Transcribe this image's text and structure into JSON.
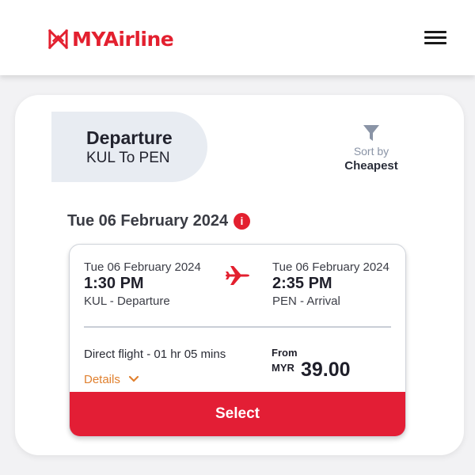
{
  "header": {
    "logo_text": "MYAirline",
    "logo_icon": "myairline-emblem",
    "menu_icon": "hamburger-menu-icon"
  },
  "colors": {
    "brand_red": "#e3202f",
    "select_button": "#e31e35",
    "details_orange": "#e0802f",
    "tab_background": "#e8ecf2",
    "sort_icon": "#8a94a6"
  },
  "tab": {
    "title": "Departure",
    "route": "KUL To PEN"
  },
  "sort": {
    "label": "Sort by",
    "value": "Cheapest",
    "icon": "filter-icon"
  },
  "date_heading": "Tue 06 February 2024",
  "info_icon": "i",
  "flight": {
    "departure": {
      "date": "Tue 06 February 2024",
      "time": "1:30 PM",
      "location": "KUL - Departure"
    },
    "arrival": {
      "date": "Tue 06 February 2024",
      "time": "2:35 PM",
      "location": "PEN - Arrival"
    },
    "duration": "Direct flight - 01 hr 05 mins",
    "details_label": "Details",
    "price_from_label": "From",
    "currency": "MYR",
    "price": "39.00",
    "select_label": "Select"
  }
}
